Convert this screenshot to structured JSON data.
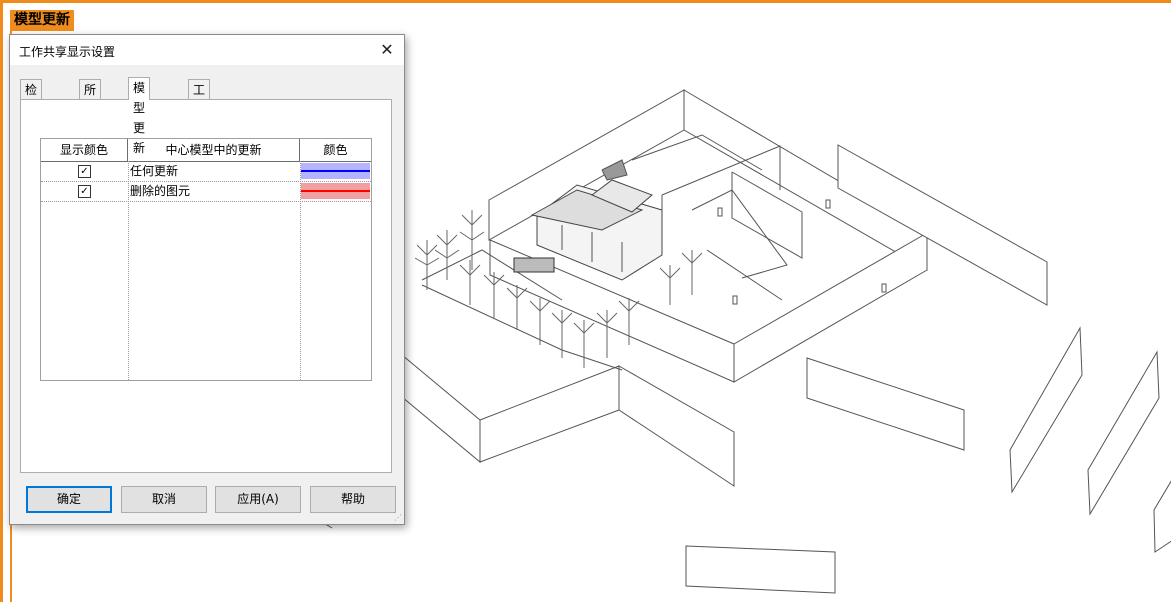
{
  "view": {
    "tag": "模型更新"
  },
  "dialog": {
    "title": "工作共享显示设置",
    "close_icon": "close-icon",
    "tabs": [
      {
        "label": "检出状态",
        "active": false
      },
      {
        "label": "所有者",
        "active": false
      },
      {
        "label": "模型更新",
        "active": true
      },
      {
        "label": "工作集",
        "active": false
      }
    ],
    "table": {
      "headers": [
        "显示颜色",
        "中心模型中的更新",
        "颜色"
      ],
      "rows": [
        {
          "checked": true,
          "label": "任何更新",
          "color_line": "#0000ff",
          "color_fill": "#b4b4ff"
        },
        {
          "checked": true,
          "label": "删除的图元",
          "color_line": "#ff0000",
          "color_fill": "#f0a0a0"
        }
      ]
    },
    "buttons": {
      "ok": "确定",
      "cancel": "取消",
      "apply": "应用(A)",
      "help": "帮助"
    }
  },
  "colors": {
    "accent": "#f08c1c",
    "dialog_bg": "#f0f0f0",
    "focus": "#0078d7"
  }
}
